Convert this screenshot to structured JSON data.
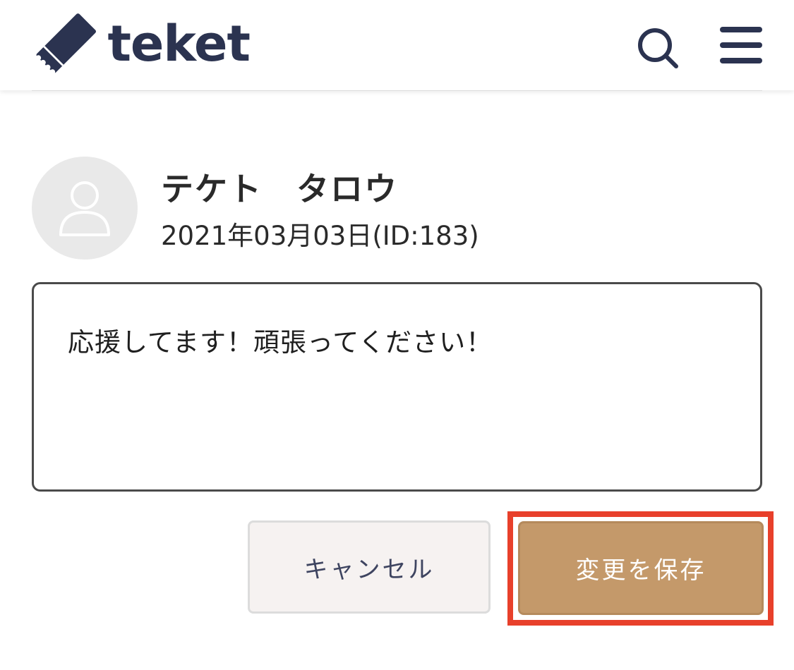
{
  "header": {
    "brand": "teket",
    "brand_color": "#2b3350",
    "logo_icon": "ticket-icon",
    "search_icon": "search-icon",
    "menu_icon": "hamburger-menu-icon"
  },
  "comment": {
    "avatar_icon": "user-avatar-icon",
    "user_name": "テケト　タロウ",
    "date_id": "2021年03月03日(ID:183)",
    "text": "応援してます！頑張ってください！"
  },
  "actions": {
    "cancel_label": "キャンセル",
    "save_label": "変更を保存",
    "save_color": "#c4996a",
    "highlight_color": "#e8402b"
  }
}
